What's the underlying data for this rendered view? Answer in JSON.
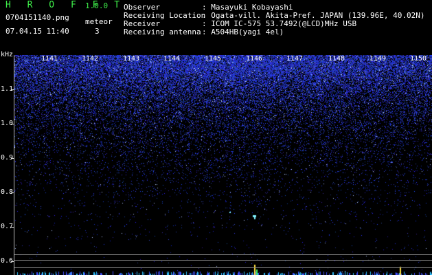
{
  "header": {
    "app_title": "H R O F F T",
    "version": "1.0.0",
    "filename": "0704151140.png",
    "datetime": "07.04.15 11:40",
    "meteor_label": "meteor",
    "meteor_count": "3"
  },
  "info": {
    "observer_label": "Observer",
    "observer_value": ": Masayuki Kobayashi",
    "location_label": "Receiving Location",
    "location_value": ": Ogata-vill. Akita-Pref. JAPAN (139.96E, 40.02N)",
    "receiver_label": "Receiver",
    "receiver_value": ": ICOM IC-575 53.7492(@LCD)MHz USB",
    "antenna_label": "Receiving antenna",
    "antenna_value": ": A504HB(yagi 4el)"
  },
  "axis": {
    "unit": "kHz",
    "y_ticks": [
      "1.1",
      "1.0",
      "0.9",
      "0.8",
      "0.7",
      "0.6"
    ],
    "x_ticks": [
      "1141",
      "1142",
      "1143",
      "1144",
      "1145",
      "1146",
      "1147",
      "1148",
      "1149",
      "1150"
    ]
  },
  "colors": {
    "noise": "#2a3cff",
    "accent": "#3ef04a",
    "meteor": "#7ff0ff",
    "peak": "#ffe040"
  }
}
